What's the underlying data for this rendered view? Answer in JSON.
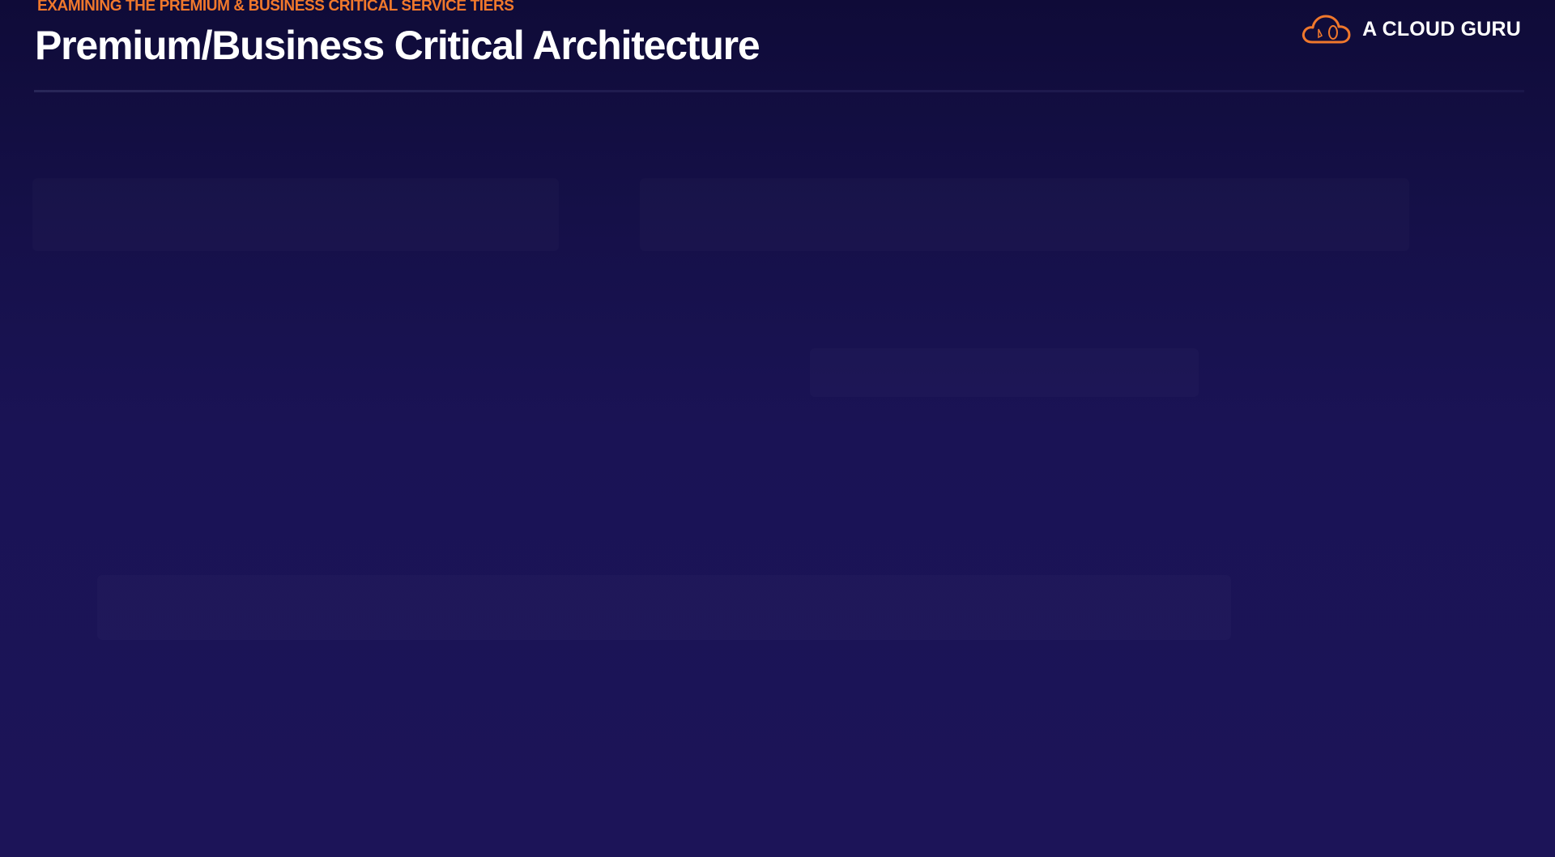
{
  "slide": {
    "eyebrow": "EXAMINING THE PREMIUM & BUSINESS CRITICAL SERVICE TIERS",
    "title": "Premium/Business Critical Architecture"
  },
  "brand": {
    "name": "A CLOUD GURU",
    "icon": "cloud-logo-icon",
    "accent_color": "#f0782c"
  },
  "colors": {
    "background_top": "#0f0b38",
    "background_bottom": "#1c1458",
    "title": "#ffffff",
    "eyebrow": "#f0782c"
  }
}
